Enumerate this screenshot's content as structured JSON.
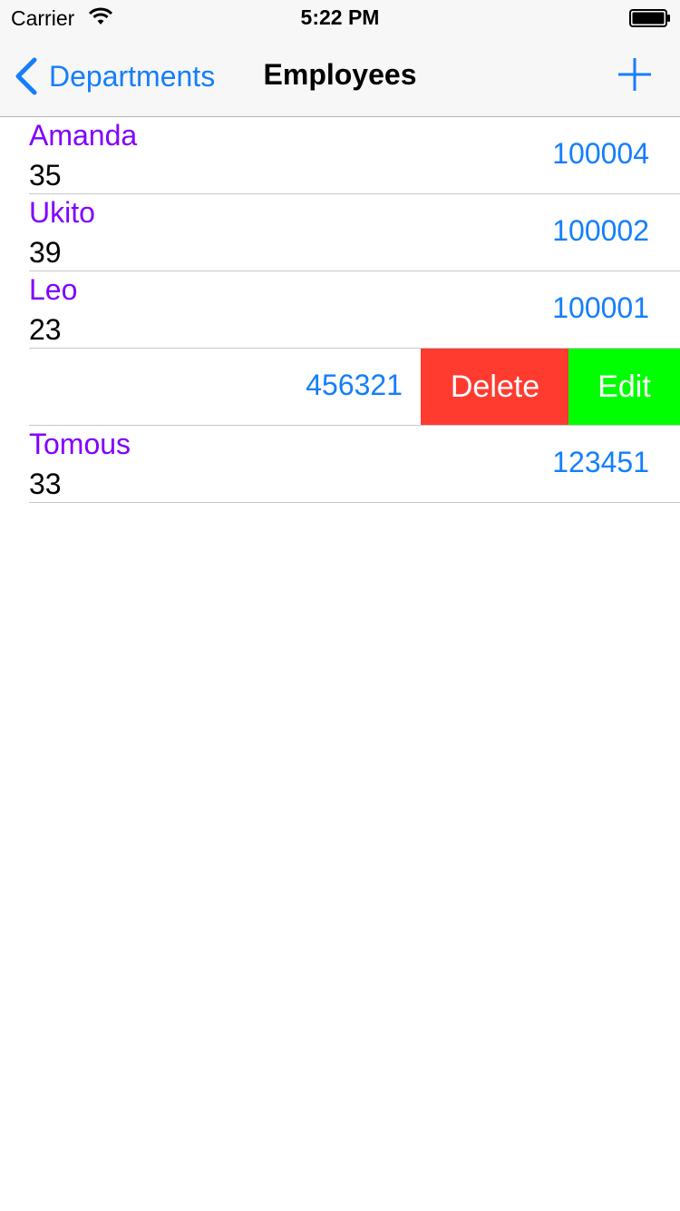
{
  "status_bar": {
    "carrier": "Carrier",
    "time": "5:22 PM",
    "wifi_icon": "wifi-icon",
    "battery_icon": "battery-icon"
  },
  "nav_bar": {
    "back_label": "Departments",
    "back_icon": "chevron-left-icon",
    "title": "Employees",
    "add_icon": "plus-icon"
  },
  "colors": {
    "tint": "#157efb",
    "name_text": "#8000ff",
    "delete_action": "#ff3b30",
    "edit_action": "#00ff00",
    "bar_background": "#f7f7f7",
    "separator": "#c8c7cc"
  },
  "employees": [
    {
      "name": "Amanda",
      "age": "35",
      "id": "100004"
    },
    {
      "name": "Ukito",
      "age": "39",
      "id": "100002"
    },
    {
      "name": "Leo",
      "age": "23",
      "id": "100001"
    },
    {
      "name": "",
      "age": "",
      "id": "456321"
    },
    {
      "name": "Tomous",
      "age": "33",
      "id": "123451"
    }
  ],
  "swipe_actions": {
    "delete_label": "Delete",
    "edit_label": "Edit"
  }
}
